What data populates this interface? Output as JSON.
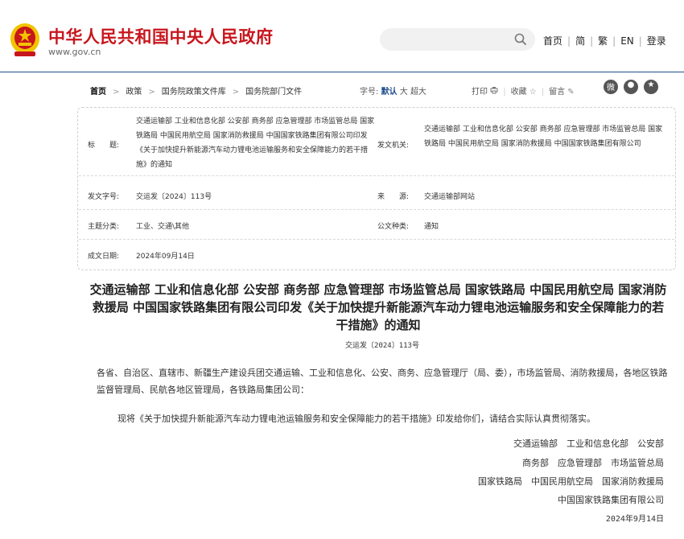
{
  "header": {
    "site_title": "中华人民共和国中央人民政府",
    "site_url": "www.gov.cn",
    "search_placeholder": "",
    "nav": [
      "首页",
      "简",
      "繁",
      "EN",
      "登录"
    ]
  },
  "breadcrumb": {
    "items": [
      "首页",
      "政策",
      "国务院政策文件库",
      "国务院部门文件"
    ]
  },
  "font_size": {
    "label": "字号:",
    "options": [
      "默认",
      "大",
      "超大"
    ],
    "selected": "默认"
  },
  "tools": {
    "print": "打印",
    "favorite": "收藏",
    "comment": "留言"
  },
  "share_icons": [
    "weibo-icon",
    "wechat-icon",
    "qzone-icon"
  ],
  "info": {
    "title_label": "标　　题:",
    "title_value": "交通运输部 工业和信息化部 公安部 商务部 应急管理部 市场监管总局 国家铁路局 中国民用航空局 国家消防救援局 中国国家铁路集团有限公司印发《关于加快提升新能源汽车动力锂电池运输服务和安全保障能力的若干措施》的通知",
    "issuer_label": "发文机关:",
    "issuer_value": "交通运输部 工业和信息化部 公安部 商务部 应急管理部 市场监管总局 国家铁路局 中国民用航空局 国家消防救援局 中国国家铁路集团有限公司",
    "doc_no_label": "发文字号:",
    "doc_no_value": "交运发〔2024〕113号",
    "source_label": "来　　源:",
    "source_value": "交通运输部网站",
    "category_label": "主题分类:",
    "category_value": "工业、交通\\其他",
    "type_label": "公文种类:",
    "type_value": "通知",
    "date_label": "成文日期:",
    "date_value": "2024年09月14日"
  },
  "document": {
    "title": "交通运输部 工业和信息化部 公安部 商务部 应急管理部 市场监管总局 国家铁路局 中国民用航空局 国家消防救援局 中国国家铁路集团有限公司印发《关于加快提升新能源汽车动力锂电池运输服务和安全保障能力的若干措施》的通知",
    "number": "交运发〔2024〕113号",
    "para1": "各省、自治区、直辖市、新疆生产建设兵团交通运输、工业和信息化、公安、商务、应急管理厅（局、委），市场监管局、消防救援局，各地区铁路监督管理局、民航各地区管理局，各铁路局集团公司：",
    "para2": "现将《关于加快提升新能源汽车动力锂电池运输服务和安全保障能力的若干措施》印发给你们，请结合实际认真贯彻落实。",
    "signatures": [
      "交通运输部　工业和信息化部　公安部",
      "商务部　应急管理部　市场监管总局",
      "国家铁路局　中国民用航空局　国家消防救援局",
      "中国国家铁路集团有限公司"
    ],
    "date": "2024年9月14日"
  },
  "colors": {
    "brand_red": "#c8161d",
    "nav_blue": "#1f4e8c",
    "emblem_gold": "#f2c300"
  }
}
